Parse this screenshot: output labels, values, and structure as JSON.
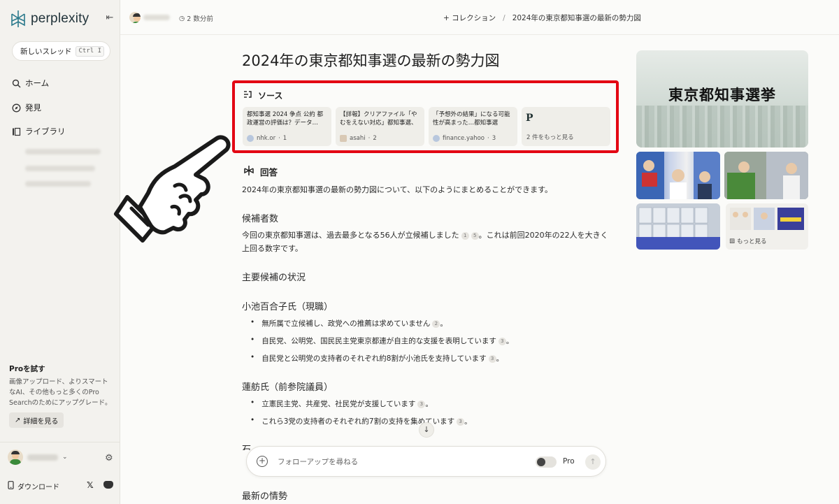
{
  "sidebar": {
    "brand": "perplexity",
    "new_thread": "新しいスレッド",
    "shortcut": "Ctrl I",
    "nav": [
      {
        "label": "ホーム",
        "icon": "search-icon"
      },
      {
        "label": "発見",
        "icon": "compass-icon"
      },
      {
        "label": "ライブラリ",
        "icon": "library-icon"
      }
    ],
    "pro": {
      "title": "Proを試す",
      "description": "画像アップロード、よりスマートなAI、その他もっと多くのPro Searchのためにアップグレード。",
      "button": "詳細を見る"
    },
    "download": "ダウンロード"
  },
  "topbar": {
    "time": "2 数分前",
    "collection": "+ コレクション",
    "separator": "/",
    "thread_title": "2024年の東京都知事選の最新の勢力図"
  },
  "main": {
    "title": "2024年の東京都知事選の最新の勢力図",
    "sources_heading": "ソース",
    "sources": [
      {
        "title": "都知事選 2024 争点 公約 都政運営の評価は？データ…",
        "site": "nhk.or",
        "num": "1"
      },
      {
        "title": "【詳報】クリアファイル「やむをえない対応」都知事選、混乱…",
        "site": "asahi",
        "num": "2"
      },
      {
        "title": "「予想外の結果」になる可能性が高まった…都知事選「最…",
        "site": "finance.yahoo",
        "num": "3"
      }
    ],
    "sources_more": "2 件をもっと見る",
    "answer_heading": "回答",
    "intro": "2024年の東京都知事選の最新の勢力図について、以下のようにまとめることができます。",
    "candidates_heading": "候補者数",
    "candidates_text_a": "今回の東京都知事選は、過去最多となる56人が立候補しました",
    "candidates_text_b": "。これは前回2020年の22人を大きく上回る数字です。",
    "main_heading": "主要候補の状況",
    "koike_heading": "小池百合子氏（現職）",
    "koike_points": [
      {
        "text": "無所属で立候補し、政党への推薦は求めていません",
        "cite": "2"
      },
      {
        "text": "自民党、公明党、国民民主党東京都連が自主的な支援を表明しています",
        "cite": "3"
      },
      {
        "text": "自民党と公明党の支持者のそれぞれ約8割が小池氏を支持しています",
        "cite": "3"
      }
    ],
    "renho_heading": "蓮舫氏（前参院議員）",
    "renho_points": [
      {
        "text": "立憲民主党、共産党、社民党が支援しています",
        "cite": "3"
      },
      {
        "text": "これら3党の支持者のそれぞれ約7割の支持を集めています",
        "cite": "3"
      }
    ],
    "cut_heading": "石",
    "latest_heading": "最新の情勢"
  },
  "followup": {
    "placeholder": "フォローアップを尋ねる",
    "pro_label": "Pro"
  },
  "media": {
    "hero_text": "東京都知事選挙",
    "more_label": "もっと見る"
  }
}
